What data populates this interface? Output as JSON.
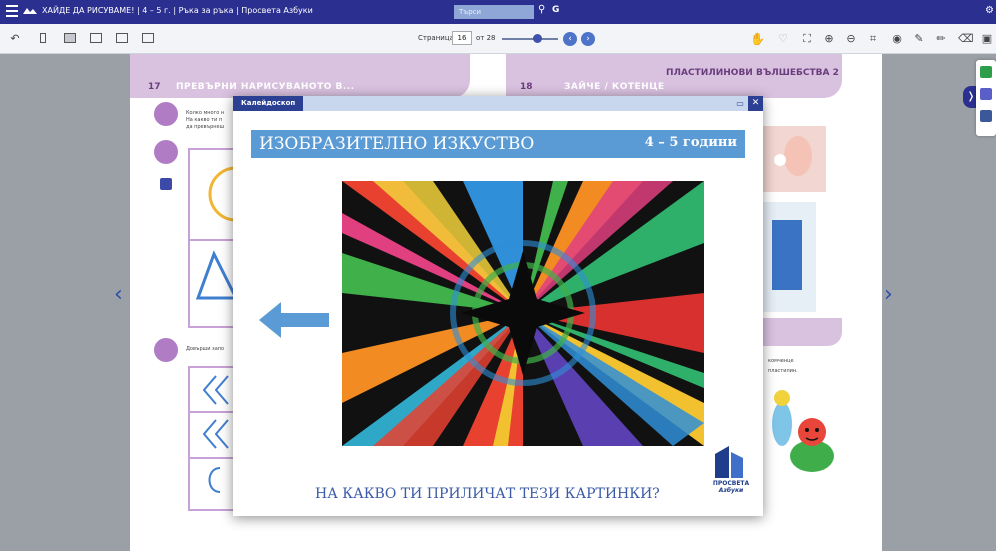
{
  "titlebar": {
    "title": "ХАЙДЕ ДА РИСУВАМЕ! | 4 – 5 г. | Ръка за ръка | Просвета Азбуки",
    "search_placeholder": "Търси"
  },
  "toolbar": {
    "page_label": "Страница",
    "page_value": "16",
    "page_of": "от 28"
  },
  "book": {
    "left_page_number": "17",
    "left_page_title": "ПРЕВЪРНИ НАРИСУВАНОТО В...",
    "left_text_1": "Колко много н",
    "left_text_2": "На какво ти п",
    "left_text_3": "да превърнеш",
    "left_text_4": "Довърши запо",
    "right_page_number": "18",
    "right_page_subtitle": "ЗАЙЧЕ / КОТЕНЦЕ",
    "right_page_title": "ПЛАСТИЛИНОВИ ВЪЛШЕБСТВА 2",
    "right_text_1": "комченце",
    "right_text_2": "пластилин."
  },
  "popup": {
    "tab_label": "Калейдоскоп",
    "banner_title": "ИЗОБРАЗИТЕЛНО ИЗКУСТВО",
    "banner_age": "4 – 5 години",
    "question": "НА КАКВО ТИ ПРИЛИЧАТ ТЕЗИ КАРТИНКИ?",
    "publisher_line1": "ПРОСВЕТА",
    "publisher_line2": "Азбуки"
  },
  "colors": {
    "titlebar": "#2b2f8f",
    "banner": "#5b9bd5",
    "page_header": "#d9c2e0",
    "accent": "#3f51a8"
  }
}
